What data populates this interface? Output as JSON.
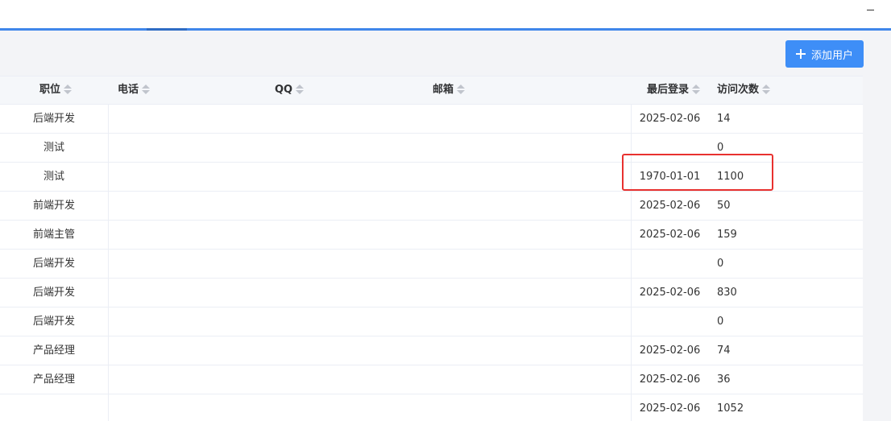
{
  "toolbar": {
    "add_user_label": "添加用户"
  },
  "table": {
    "headers": {
      "role": "职位",
      "phone": "电话",
      "qq": "QQ",
      "email": "邮箱",
      "last_login": "最后登录",
      "visits": "访问次数"
    },
    "rows": [
      {
        "role": "后端开发",
        "last_login": "2025-02-06",
        "visits": "14"
      },
      {
        "role": "测试",
        "last_login": "",
        "visits": "0"
      },
      {
        "role": "测试",
        "last_login": "1970-01-01",
        "visits": "1100"
      },
      {
        "role": "前端开发",
        "last_login": "2025-02-06",
        "visits": "50"
      },
      {
        "role": "前端主管",
        "last_login": "2025-02-06",
        "visits": "159"
      },
      {
        "role": "后端开发",
        "last_login": "",
        "visits": "0"
      },
      {
        "role": "后端开发",
        "last_login": "2025-02-06",
        "visits": "830"
      },
      {
        "role": "后端开发",
        "last_login": "",
        "visits": "0"
      },
      {
        "role": "产品经理",
        "last_login": "2025-02-06",
        "visits": "74"
      },
      {
        "role": "产品经理",
        "last_login": "2025-02-06",
        "visits": "36"
      },
      {
        "role": "",
        "last_login": "2025-02-06",
        "visits": "1052"
      }
    ]
  },
  "colors": {
    "accent": "#3f86ea",
    "primary_button": "#3e8ef7",
    "highlight": "#e8312f"
  }
}
